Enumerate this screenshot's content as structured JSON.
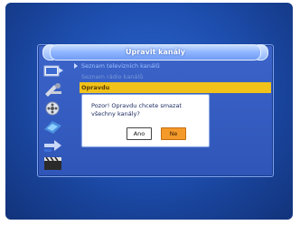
{
  "menu_title": "Upravit kanály",
  "menu_items": [
    {
      "label": "Seznam televizních kanálů",
      "state": "normal"
    },
    {
      "label": "Seznam rádio kanálů",
      "state": "disabled"
    },
    {
      "label": "Opravdu",
      "state": "selected"
    }
  ],
  "side_icons": [
    "satellite-dish-icon",
    "tools-icon",
    "film-reel-icon",
    "network-icon",
    "arrow-icon",
    "clapperboard-icon"
  ],
  "dialog": {
    "message": "Pozor! Opravdu chcete smazat\nvšechny kanály?",
    "yes_label": "Ano",
    "no_label": "Ne"
  },
  "colors": {
    "background": "#1e4fb0",
    "selection": "#f0c21a",
    "no_button": "#f49a2b"
  }
}
